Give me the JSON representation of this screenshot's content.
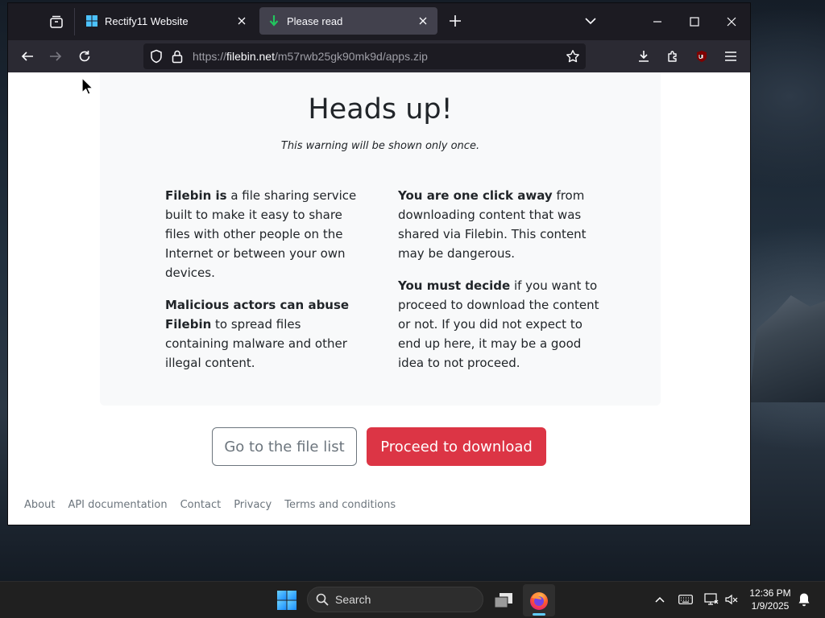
{
  "browser": {
    "tabs": [
      {
        "title": "Rectify11 Website",
        "active": false
      },
      {
        "title": "Please read",
        "active": true
      }
    ],
    "url": {
      "prefix": "https://",
      "host": "filebin.net",
      "path": "/m57rwb25gk90mk9d/apps.zip"
    }
  },
  "page": {
    "heading": "Heads up!",
    "subheading": "This warning will be shown only once.",
    "left_col": {
      "p1_bold": "Filebin is",
      "p1_text": " a file sharing service built to make it easy to share files with other people on the Internet or between your own devices.",
      "p2_bold": "Malicious actors can abuse Filebin",
      "p2_text": " to spread files containing malware and other illegal content."
    },
    "right_col": {
      "p1_bold": "You are one click away",
      "p1_text": " from downloading content that was shared via Filebin. This content may be dangerous.",
      "p2_bold": "You must decide",
      "p2_text": " if you want to proceed to download the content or not. If you did not expect to end up here, it may be a good idea to not proceed."
    },
    "buttons": {
      "file_list": "Go to the file list",
      "proceed": "Proceed to download"
    },
    "footer": [
      "About",
      "API documentation",
      "Contact",
      "Privacy",
      "Terms and conditions"
    ]
  },
  "taskbar": {
    "search_placeholder": "Search",
    "time": "12:36 PM",
    "date": "1/9/2025"
  },
  "colors": {
    "danger": "#dc3545",
    "tab_active": "#42414d",
    "url_bar": "#1c1b22"
  }
}
